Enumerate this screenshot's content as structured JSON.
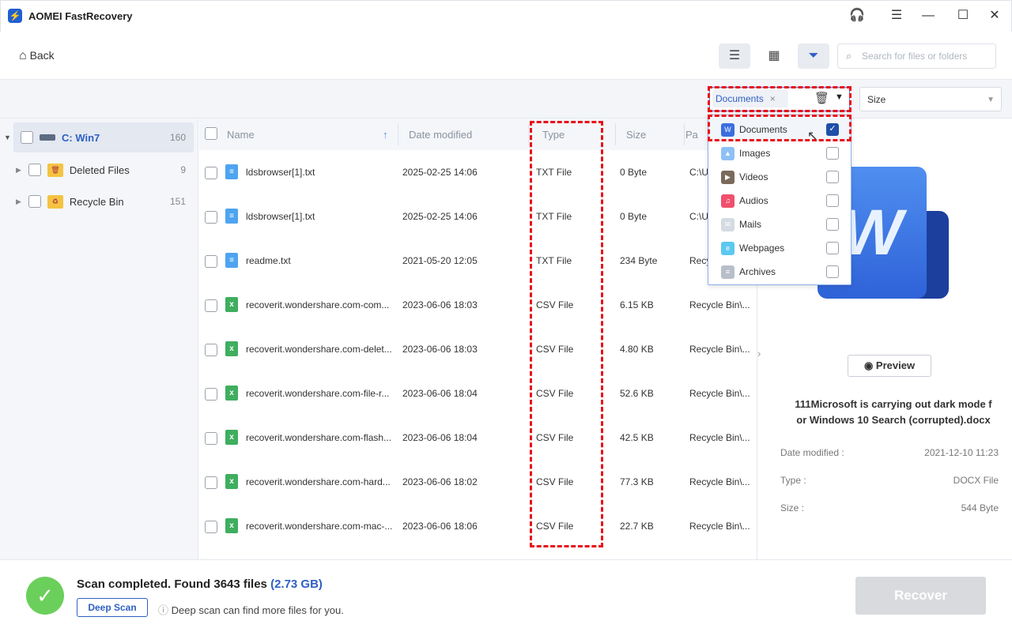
{
  "app": {
    "title": "AOMEI FastRecovery"
  },
  "toolbar": {
    "back_label": "Back",
    "search_placeholder": "Search for files or folders"
  },
  "filter": {
    "type_chip": "Documents",
    "size_label": "Size"
  },
  "sidebar": {
    "items": [
      {
        "label": "C: Win7",
        "count": "160"
      },
      {
        "label": "Deleted Files",
        "count": "9"
      },
      {
        "label": "Recycle Bin",
        "count": "151"
      }
    ]
  },
  "table": {
    "columns": {
      "name": "Name",
      "date": "Date modified",
      "type": "Type",
      "size": "Size",
      "path": "Pa"
    },
    "rows": [
      {
        "name": "ldsbrowser[1].txt",
        "date": "2025-02-25 14:06",
        "type": "TXT File",
        "size": "0 Byte",
        "path": "C:\\U",
        "kind": "txt"
      },
      {
        "name": "ldsbrowser[1].txt",
        "date": "2025-02-25 14:06",
        "type": "TXT File",
        "size": "0 Byte",
        "path": "C:\\U",
        "kind": "txt"
      },
      {
        "name": "readme.txt",
        "date": "2021-05-20 12:05",
        "type": "TXT File",
        "size": "234 Byte",
        "path": "Recy",
        "kind": "txt"
      },
      {
        "name": "recoverit.wondershare.com-com...",
        "date": "2023-06-06 18:03",
        "type": "CSV File",
        "size": "6.15 KB",
        "path": "Recycle Bin\\...",
        "kind": "csv"
      },
      {
        "name": "recoverit.wondershare.com-delet...",
        "date": "2023-06-06 18:03",
        "type": "CSV File",
        "size": "4.80 KB",
        "path": "Recycle Bin\\...",
        "kind": "csv"
      },
      {
        "name": "recoverit.wondershare.com-file-r...",
        "date": "2023-06-06 18:04",
        "type": "CSV File",
        "size": "52.6 KB",
        "path": "Recycle Bin\\...",
        "kind": "csv"
      },
      {
        "name": "recoverit.wondershare.com-flash...",
        "date": "2023-06-06 18:04",
        "type": "CSV File",
        "size": "42.5 KB",
        "path": "Recycle Bin\\...",
        "kind": "csv"
      },
      {
        "name": "recoverit.wondershare.com-hard...",
        "date": "2023-06-06 18:02",
        "type": "CSV File",
        "size": "77.3 KB",
        "path": "Recycle Bin\\...",
        "kind": "csv"
      },
      {
        "name": "recoverit.wondershare.com-mac-...",
        "date": "2023-06-06 18:06",
        "type": "CSV File",
        "size": "22.7 KB",
        "path": "Recycle Bin\\...",
        "kind": "csv"
      }
    ]
  },
  "dropdown": {
    "items": [
      {
        "label": "Documents",
        "checked": true,
        "color": "#3a6fe0",
        "glyph": "W"
      },
      {
        "label": "Images",
        "checked": false,
        "color": "#8ec0f5",
        "glyph": "▲"
      },
      {
        "label": "Videos",
        "checked": false,
        "color": "#7a6a5a",
        "glyph": "▶"
      },
      {
        "label": "Audios",
        "checked": false,
        "color": "#f0506e",
        "glyph": "♫"
      },
      {
        "label": "Mails",
        "checked": false,
        "color": "#d5dbe2",
        "glyph": "✉"
      },
      {
        "label": "Webpages",
        "checked": false,
        "color": "#5cc8f0",
        "glyph": "e"
      },
      {
        "label": "Archives",
        "checked": false,
        "color": "#b9bfca",
        "glyph": "≡"
      }
    ]
  },
  "preview": {
    "button": "Preview",
    "filename": "111Microsoft is carrying out dark mode for Windows 10 Search (corrupted).docx",
    "filename_line1": "111Microsoft is carrying out dark mode f",
    "filename_line2": "or Windows 10 Search (corrupted).docx",
    "date_label": "Date modified :",
    "date_value": "2021-12-10 11:23",
    "type_label": "Type :",
    "type_value": "DOCX File",
    "size_label": "Size :",
    "size_value": "544 Byte"
  },
  "footer": {
    "status": "Scan completed. Found 3643 files",
    "total": "(2.73 GB)",
    "deep_scan": "Deep Scan",
    "hint": "Deep scan can find more files for you.",
    "recover": "Recover"
  },
  "colors": {
    "accent": "#2f5fc3",
    "highlight": "#e8101a",
    "success": "#6bcf5b"
  }
}
